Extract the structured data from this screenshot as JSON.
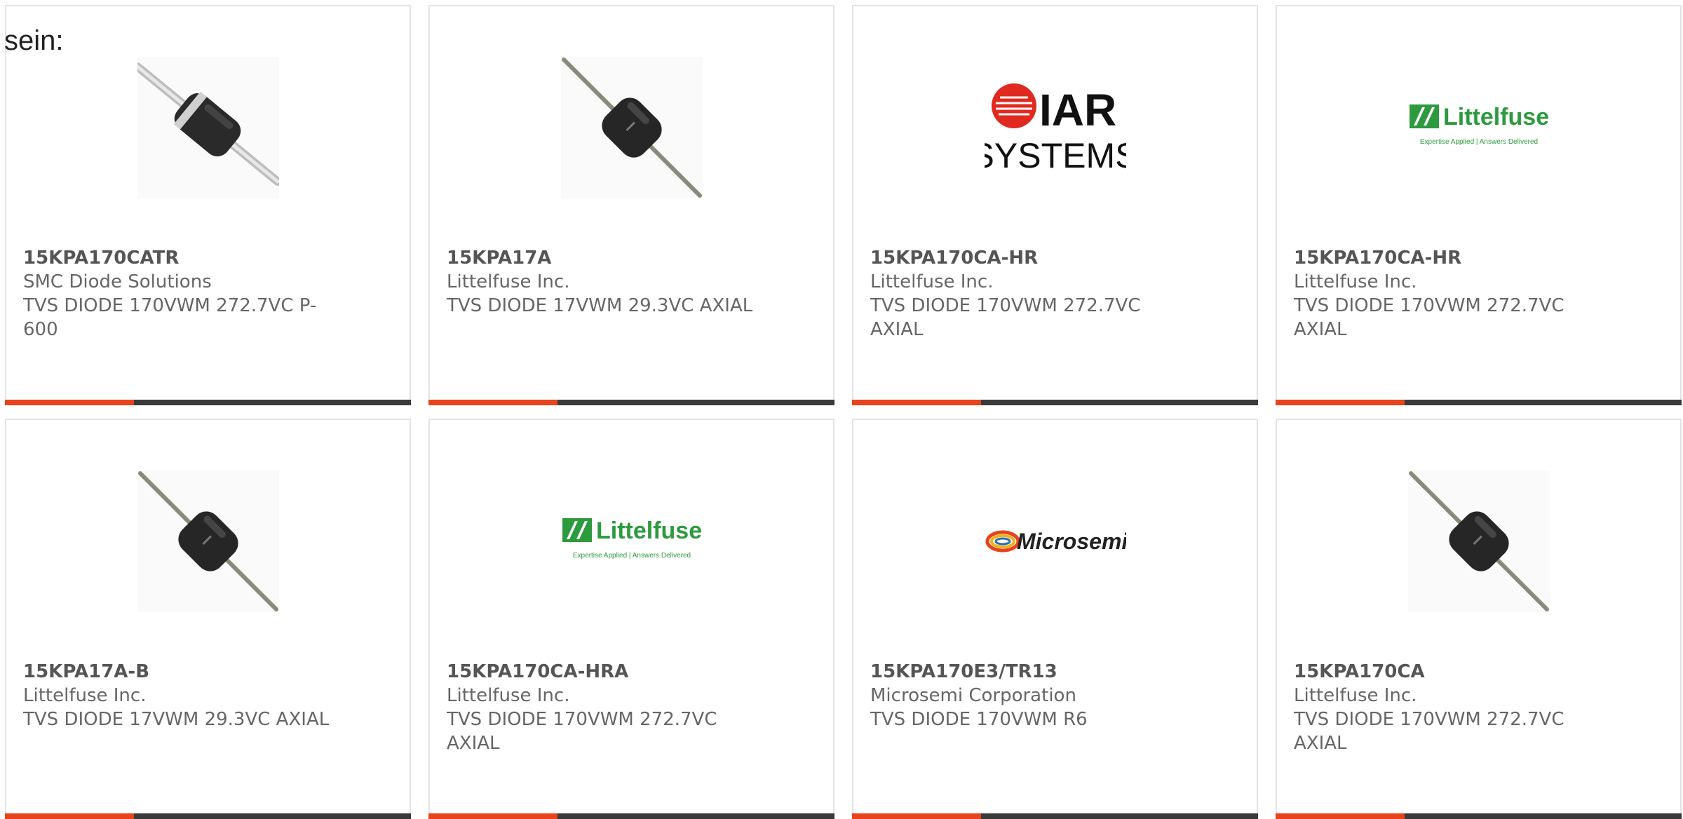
{
  "intro_text": "sein:",
  "colors": {
    "accent": "#e8431c",
    "bar": "#3a3a3a",
    "border": "#e3e3e3",
    "text": "#666666"
  },
  "products": [
    {
      "part_number": "15KPA170CATR",
      "manufacturer": "SMC Diode Solutions",
      "description": "TVS DIODE 170VWM 272.7VC P-600",
      "image": "diode-banded-icon"
    },
    {
      "part_number": "15KPA17A",
      "manufacturer": "Littelfuse Inc.",
      "description": "TVS DIODE 17VWM 29.3VC AXIAL",
      "image": "diode-axial-icon"
    },
    {
      "part_number": "15KPA170CA-HR",
      "manufacturer": "Littelfuse Inc.",
      "description": "TVS DIODE 170VWM 272.7VC AXIAL",
      "image": "iar-systems-logo",
      "logo_text": [
        "IAR",
        "SYSTEMS"
      ]
    },
    {
      "part_number": "15KPA170CA-HR",
      "manufacturer": "Littelfuse Inc.",
      "description": "TVS DIODE 170VWM 272.7VC AXIAL",
      "image": "littelfuse-logo",
      "logo_text": [
        "Littelfuse",
        "Expertise Applied | Answers Delivered"
      ]
    },
    {
      "part_number": "15KPA17A-B",
      "manufacturer": "Littelfuse Inc.",
      "description": "TVS DIODE 17VWM 29.3VC AXIAL",
      "image": "diode-axial-icon"
    },
    {
      "part_number": "15KPA170CA-HRA",
      "manufacturer": "Littelfuse Inc.",
      "description": "TVS DIODE 170VWM 272.7VC AXIAL",
      "image": "littelfuse-logo",
      "logo_text": [
        "Littelfuse",
        "Expertise Applied | Answers Delivered"
      ]
    },
    {
      "part_number": "15KPA170E3/TR13",
      "manufacturer": "Microsemi Corporation",
      "description": "TVS DIODE 170VWM R6",
      "image": "microsemi-logo",
      "logo_text": [
        "Microsemi"
      ]
    },
    {
      "part_number": "15KPA170CA",
      "manufacturer": "Littelfuse Inc.",
      "description": "TVS DIODE 170VWM 272.7VC AXIAL",
      "image": "diode-axial-icon"
    }
  ]
}
